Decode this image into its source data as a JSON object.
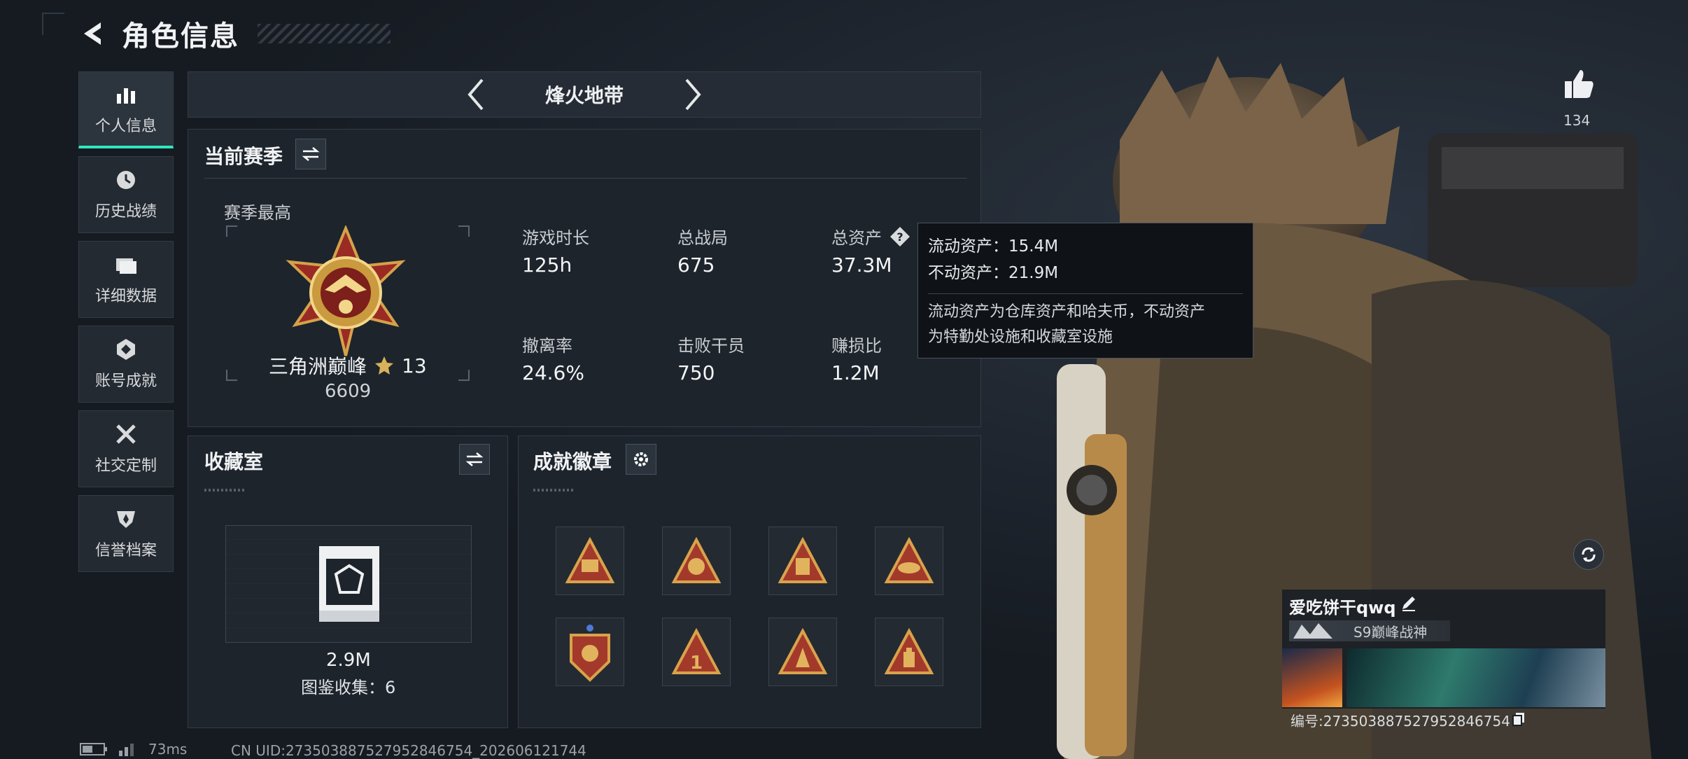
{
  "header": {
    "title": "角色信息"
  },
  "sidebar": {
    "items": [
      {
        "label": "个人信息",
        "icon": "bar-chart-icon",
        "active": true
      },
      {
        "label": "历史战绩",
        "icon": "history-clock-icon",
        "active": false
      },
      {
        "label": "详细数据",
        "icon": "folder-icon",
        "active": false
      },
      {
        "label": "账号成就",
        "icon": "achievement-icon",
        "active": false
      },
      {
        "label": "社交定制",
        "icon": "tools-icon",
        "active": false
      },
      {
        "label": "信誉档案",
        "icon": "credit-shield-icon",
        "active": false
      }
    ]
  },
  "mode": {
    "name": "烽火地带"
  },
  "season": {
    "title": "当前赛季",
    "best_label": "赛季最高",
    "rank_name": "三角洲巅峰",
    "rank_stars": "13",
    "rank_score": "6609",
    "stats": [
      {
        "label": "游戏时长",
        "value": "125h"
      },
      {
        "label": "总战局",
        "value": "675"
      },
      {
        "label": "总资产",
        "value": "37.3M"
      },
      {
        "label": "撤离率",
        "value": "24.6%"
      },
      {
        "label": "击败干员",
        "value": "750"
      },
      {
        "label": "赚损比",
        "value": "1.2M"
      }
    ]
  },
  "tooltip": {
    "liquid": "流动资产：15.4M",
    "fixed": "不动资产：21.9M",
    "desc_line1": "流动资产为仓库资产和哈夫币，不动资产",
    "desc_line2": "为特勤处设施和收藏室设施"
  },
  "collection": {
    "title": "收藏室",
    "value": "2.9M",
    "count_text": "图鉴收集：6"
  },
  "achievements": {
    "title": "成就徽章",
    "badges": [
      "badge-1",
      "badge-2",
      "badge-3",
      "badge-4",
      "badge-5",
      "badge-6",
      "badge-7",
      "badge-8"
    ]
  },
  "profile": {
    "likes": "134",
    "nickname": "爱吃饼干qwq",
    "title_badge": "S9巅峰战神",
    "id_text": "编号:273503887527952846754"
  },
  "status": {
    "ping": "73ms",
    "uid": "CN UID:273503887527952846754_202606121744"
  },
  "colors": {
    "accent": "#2ee6c0",
    "gold": "#c99a3e",
    "panel": "#1d242c"
  }
}
